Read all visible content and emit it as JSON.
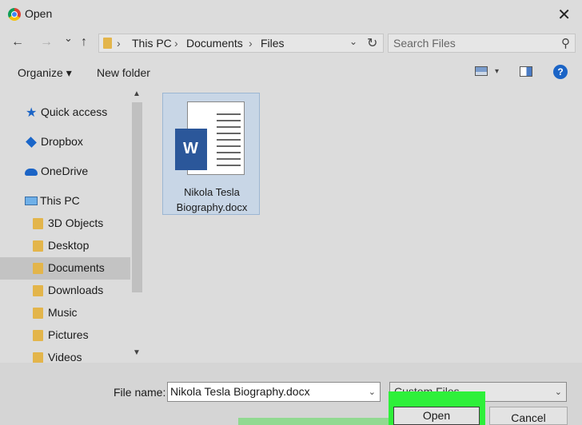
{
  "window": {
    "title": "Open",
    "close_symbol": "✕"
  },
  "address": {
    "back_symbol": "←",
    "forward_symbol": "→",
    "recent_symbol": "⌄",
    "up_symbol": "↑",
    "breadcrumbs": [
      "This PC",
      "Documents",
      "Files"
    ],
    "separator": "›",
    "dropdown_symbol": "⌄",
    "refresh_symbol": "↻"
  },
  "search": {
    "placeholder": "Search Files",
    "icon_symbol": "⚲"
  },
  "toolbar": {
    "organize_label": "Organize ▾",
    "new_folder_label": "New folder",
    "view_dropdown_symbol": "▾",
    "help_symbol": "?"
  },
  "nav": {
    "items": [
      {
        "label": "Quick access",
        "icon": "star-icon",
        "selected": false
      },
      {
        "label": "Dropbox",
        "icon": "dropbox-icon",
        "selected": false
      },
      {
        "label": "OneDrive",
        "icon": "cloud-icon",
        "selected": false
      },
      {
        "label": "This PC",
        "icon": "pc-icon",
        "selected": false
      },
      {
        "label": "3D Objects",
        "icon": "folder-icon",
        "selected": false
      },
      {
        "label": "Desktop",
        "icon": "folder-icon",
        "selected": false
      },
      {
        "label": "Documents",
        "icon": "folder-icon",
        "selected": true
      },
      {
        "label": "Downloads",
        "icon": "folder-icon",
        "selected": false
      },
      {
        "label": "Music",
        "icon": "folder-icon",
        "selected": false
      },
      {
        "label": "Pictures",
        "icon": "folder-icon",
        "selected": false
      },
      {
        "label": "Videos",
        "icon": "folder-icon",
        "selected": false
      }
    ],
    "scroll_up_symbol": "▲",
    "scroll_down_symbol": "▼"
  },
  "files": [
    {
      "name_line1": "Nikola Tesla",
      "name_line2": "Biography.docx",
      "badge": "W",
      "selected": true
    }
  ],
  "footer": {
    "file_name_label": "File name:",
    "file_name_value": "Nikola Tesla Biography.docx",
    "file_type_value": "Custom Files",
    "dropdown_symbol": "⌄",
    "open_label": "Open",
    "cancel_label": "Cancel"
  },
  "colors": {
    "accent": "#1b64c6",
    "highlight": "#2ef03a",
    "selection": "#c8d6e6"
  }
}
